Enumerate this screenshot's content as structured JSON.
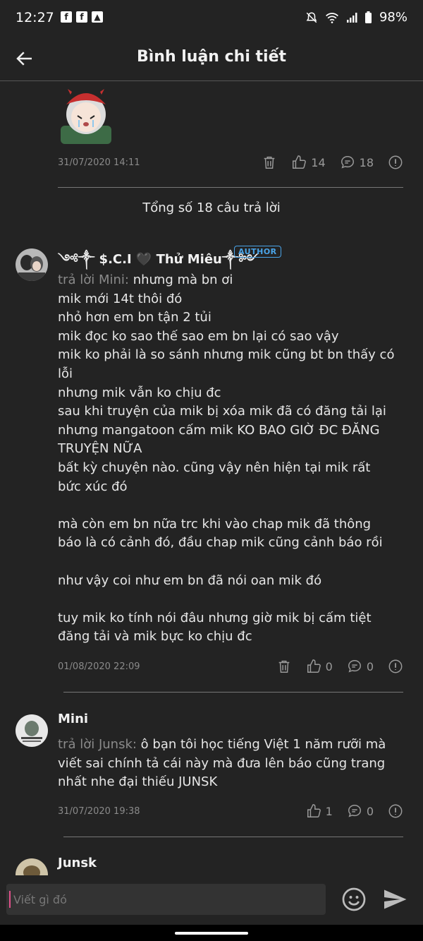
{
  "status": {
    "time": "12:27",
    "battery": "98%"
  },
  "header": {
    "title": "Bình luận chi tiết"
  },
  "main_comment": {
    "date": "31/07/2020 14:11",
    "likes": "14",
    "replies": "18"
  },
  "total_replies": "Tổng số 18 câu trả lời",
  "replies": [
    {
      "username": "༺༒ $.C.I 🖤 Thử Miêu༒༻",
      "badge": "AUTHOR",
      "reply_to": "trả lời Mini:",
      "lines": [
        "nhưng mà bn ơi",
        "mik mới 14t thôi đó",
        "nhỏ hơn em bn tận 2 tủi",
        "mik đọc ko sao thế sao em bn lại có sao vậy",
        "mik ko phải là so sánh nhưng mik cũng bt bn thấy có lỗi",
        "nhưng mik vẫn ko chịu đc",
        "sau khi truyện của mik bị xóa mik đã có đăng tải lại nhưng mangatoon cấm mik KO BAO GIỜ ĐC ĐĂNG TRUYỆN NỮA",
        "bất kỳ chuyện nào. cũng vậy nên hiện tại mik rất bức xúc đó",
        "mà còn em bn nữa trc khi vào chap mik đã thông báo là có cảnh đó, đầu chap mik cũng cảnh báo rồi",
        "như vậy coi như em bn đã nói oan mik đó",
        "tuy mik ko tính nói đâu nhưng giờ mik bị cấm tiệt đăng tải và mik bực ko chịu đc"
      ],
      "date": "01/08/2020 22:09",
      "likes": "0",
      "replies": "0"
    },
    {
      "username": "Mini",
      "reply_to": "trả lời Junsk:",
      "text": "ô bạn tôi học tiếng Việt 1 năm rưỡi mà viết sai chính tả cái này mà đưa lên báo cũng trang nhất nhe đại thiếu JUNSK",
      "date": "31/07/2020 19:38",
      "likes": "1",
      "replies": "0"
    },
    {
      "username": "Junsk"
    }
  ],
  "composer": {
    "placeholder": "Viết gì đó"
  }
}
